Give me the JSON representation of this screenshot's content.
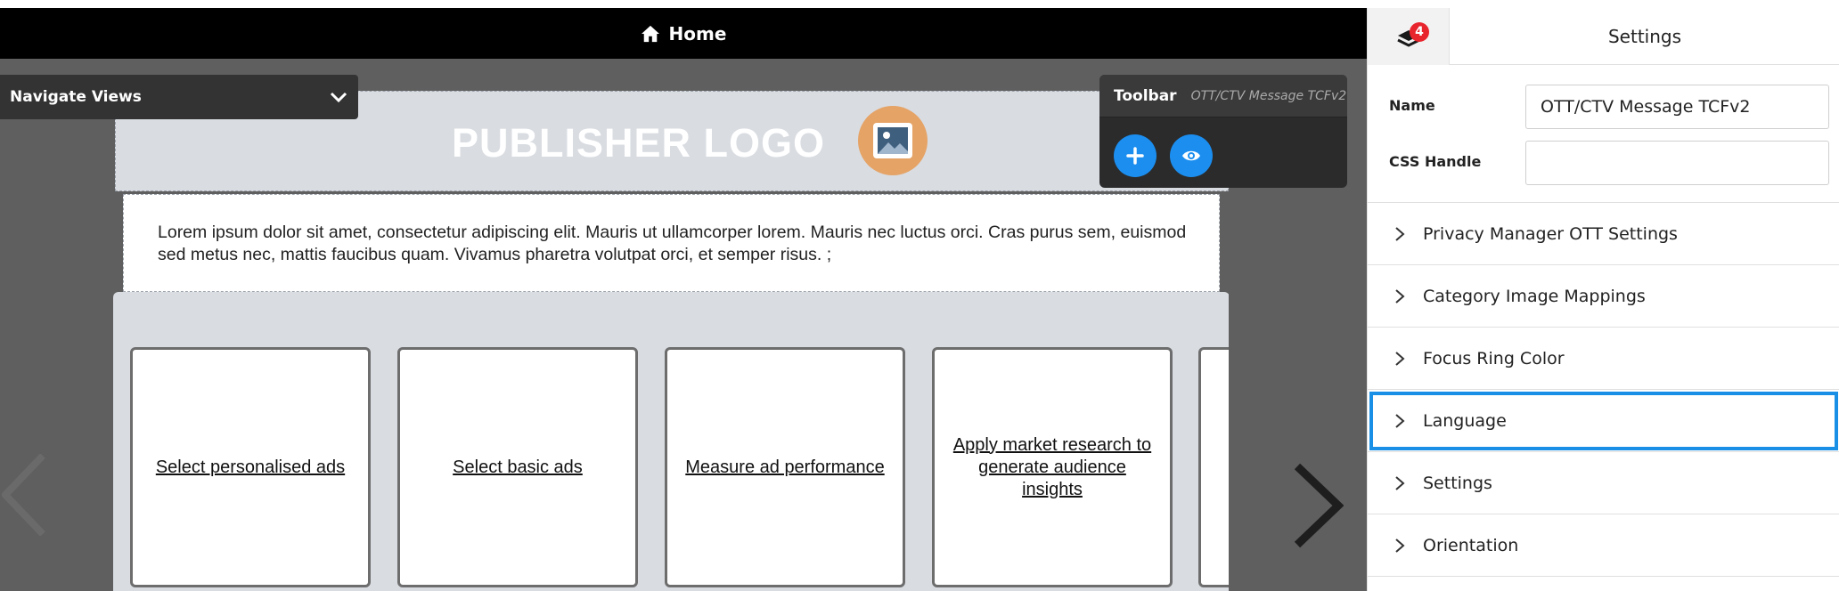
{
  "header": {
    "home_label": "Home",
    "home_icon": "home-icon"
  },
  "navigate_views": {
    "label": "Navigate Views",
    "icon": "chevron-down-icon"
  },
  "message": {
    "logo_text": "PUBLISHER LOGO",
    "logo_icon": "image-icon",
    "body_text": "Lorem ipsum dolor sit amet, consectetur adipiscing elit. Mauris ut ullamcorper lorem. Mauris nec luctus orci. Cras purus sem, euismod sed metus nec, mattis faucibus quam. Vivamus pharetra volutpat orci, et semper risus. ;",
    "cards": [
      {
        "label": "Select personalised ads"
      },
      {
        "label": "Select basic ads"
      },
      {
        "label": "Measure ad performance"
      },
      {
        "label": "Apply market research to generate audience insights"
      }
    ]
  },
  "toolbar": {
    "title": "Toolbar",
    "subtitle": "OTT/CTV Message TCFv2",
    "add_icon": "plus-icon",
    "preview_icon": "eye-icon"
  },
  "panel": {
    "title": "Settings",
    "notification_count": "4",
    "notification_icon": "layers-icon",
    "fields": {
      "name_label": "Name",
      "name_value": "OTT/CTV Message TCFv2",
      "css_label": "CSS Handle",
      "css_value": ""
    },
    "sections": [
      {
        "label": "Privacy Manager OTT Settings"
      },
      {
        "label": "Category Image Mappings"
      },
      {
        "label": "Focus Ring Color"
      },
      {
        "label": "Language"
      },
      {
        "label": "Settings"
      },
      {
        "label": "Orientation"
      }
    ],
    "focus_color": "#1a8fe6"
  },
  "colors": {
    "accent": "#1b8ef0",
    "badge": "#e8242c",
    "logo_circle": "#e5a366"
  }
}
